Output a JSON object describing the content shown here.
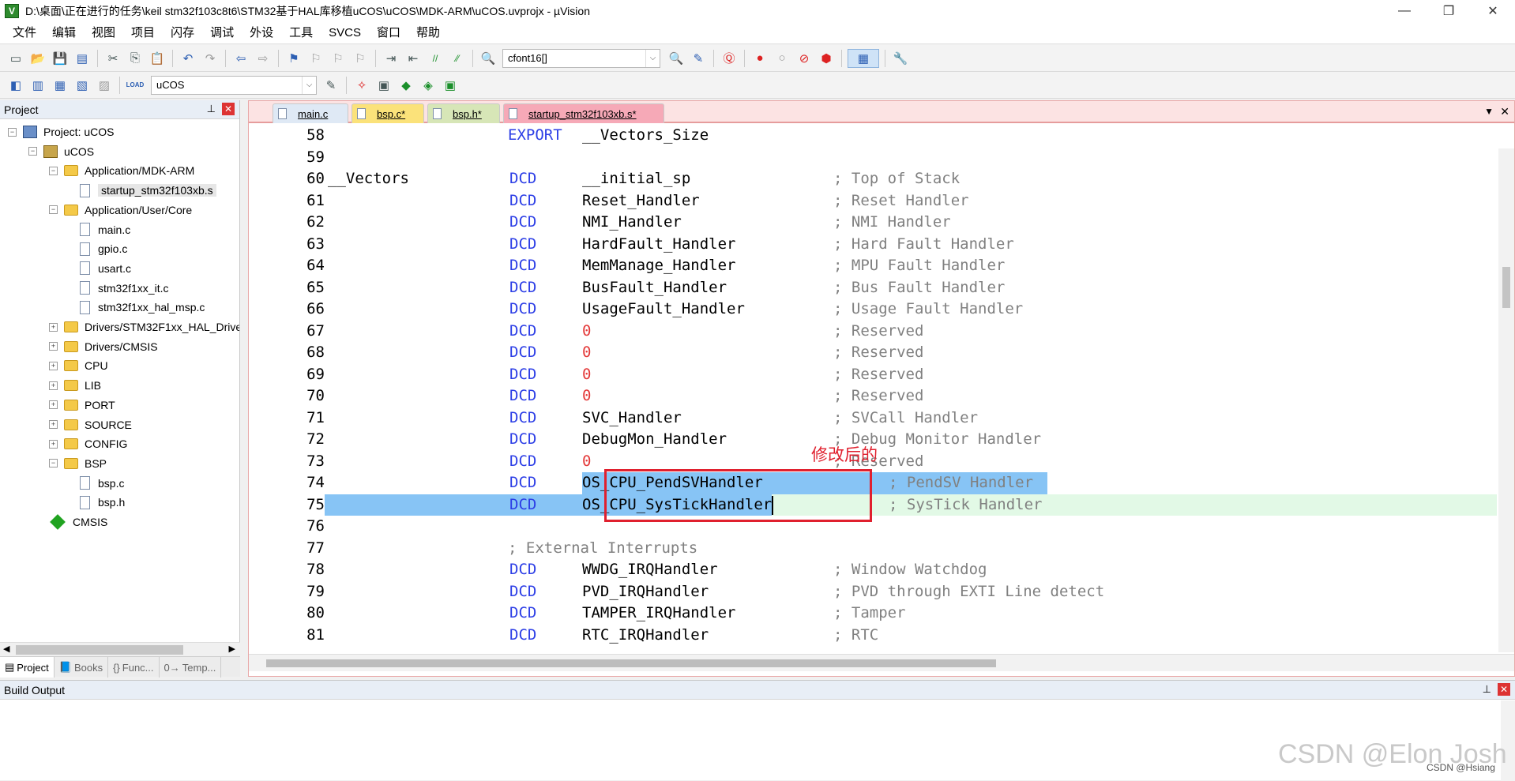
{
  "window": {
    "title": "D:\\桌面\\正在进行的任务\\keil stm32f103c8t6\\STM32基于HAL库移植uCOS\\uCOS\\MDK-ARM\\uCOS.uvprojx - µVision",
    "app_icon_letter": "V",
    "minimize_glyph": "—",
    "maximize_glyph": "❐",
    "close_glyph": "✕"
  },
  "menu": [
    "文件",
    "编辑",
    "视图",
    "项目",
    "闪存",
    "调试",
    "外设",
    "工具",
    "SVCS",
    "窗口",
    "帮助"
  ],
  "toolbar": {
    "find_combo_value": "cfont16[]",
    "target_combo_value": "uCOS",
    "combo_arrow": "⌵",
    "icons": {
      "new_file": "▭",
      "open": "📂",
      "save": "💾",
      "save_all": "▤",
      "cut": "✂",
      "copy": "⎘",
      "paste": "📋",
      "undo": "↶",
      "redo": "↷",
      "back": "⇦",
      "forward": "⇨",
      "bookmark": "⚑",
      "bookmark_prev": "⚐",
      "bookmark_next": "⚐",
      "bookmark_clear": "⚐",
      "indent": "⇥",
      "unindent": "⇤",
      "comment": "//",
      "uncomment": "⁄⁄",
      "find_in_files": "🔍",
      "debug": "Ⓠ",
      "breakpoint": "●",
      "breakpoint_disable": "○",
      "breakpoint_disable_all": "⊘",
      "breakpoint_kill": "⬢",
      "window": "▦",
      "config": "🔧",
      "translate": "◧",
      "build": "▥",
      "rebuild": "▦",
      "batch_build": "▧",
      "stop_build": "▨",
      "load": "LOAD",
      "target_options": "✎",
      "manage_components": "✧",
      "select_packs": "◆",
      "pack_installer": "◈",
      "rte": "▣"
    }
  },
  "project_panel": {
    "title": "Project",
    "pin": "⊥",
    "close": "✕",
    "tree": [
      {
        "label": "Project: uCOS",
        "level": 0,
        "type": "project",
        "expander": "−"
      },
      {
        "label": "uCOS",
        "level": 1,
        "type": "target",
        "expander": "−"
      },
      {
        "label": "Application/MDK-ARM",
        "level": 2,
        "type": "folder",
        "expander": "−"
      },
      {
        "label": "startup_stm32f103xb.s",
        "level": 3,
        "type": "file",
        "selected": true
      },
      {
        "label": "Application/User/Core",
        "level": 2,
        "type": "folder",
        "expander": "−"
      },
      {
        "label": "main.c",
        "level": 3,
        "type": "file"
      },
      {
        "label": "gpio.c",
        "level": 3,
        "type": "file"
      },
      {
        "label": "usart.c",
        "level": 3,
        "type": "file"
      },
      {
        "label": "stm32f1xx_it.c",
        "level": 3,
        "type": "file"
      },
      {
        "label": "stm32f1xx_hal_msp.c",
        "level": 3,
        "type": "file"
      },
      {
        "label": "Drivers/STM32F1xx_HAL_Drive",
        "level": 2,
        "type": "folder",
        "expander": "+"
      },
      {
        "label": "Drivers/CMSIS",
        "level": 2,
        "type": "folder",
        "expander": "+"
      },
      {
        "label": "CPU",
        "level": 2,
        "type": "folder",
        "expander": "+"
      },
      {
        "label": "LIB",
        "level": 2,
        "type": "folder",
        "expander": "+"
      },
      {
        "label": "PORT",
        "level": 2,
        "type": "folder",
        "expander": "+"
      },
      {
        "label": "SOURCE",
        "level": 2,
        "type": "folder",
        "expander": "+"
      },
      {
        "label": "CONFIG",
        "level": 2,
        "type": "folder",
        "expander": "+"
      },
      {
        "label": "BSP",
        "level": 2,
        "type": "folder",
        "expander": "−"
      },
      {
        "label": "bsp.c",
        "level": 3,
        "type": "file"
      },
      {
        "label": "bsp.h",
        "level": 3,
        "type": "file"
      },
      {
        "label": "CMSIS",
        "level": 2,
        "type": "gem"
      }
    ],
    "scroll_left": "◀",
    "scroll_right": "▶",
    "tabs": [
      {
        "label": "Project",
        "icon": "▤",
        "active": true
      },
      {
        "label": "Books",
        "icon": "📘",
        "active": false
      },
      {
        "label": "Func...",
        "icon": "{}",
        "active": false
      },
      {
        "label": "Temp...",
        "icon": "0→",
        "active": false
      }
    ]
  },
  "editor": {
    "tabs": [
      {
        "label": "main.c",
        "color": "#dfe9f5"
      },
      {
        "label": "bsp.c*",
        "color": "#fbe27a"
      },
      {
        "label": "bsp.h*",
        "color": "#d7e6b7"
      },
      {
        "label": "startup_stm32f103xb.s*",
        "color": "#f6a9b7",
        "active": true
      }
    ],
    "tab_dropdown": "▼",
    "tab_close": "✕",
    "lines": [
      {
        "n": "58",
        "label": "",
        "op": "EXPORT",
        "arg": "__Vectors_Size",
        "comment": ""
      },
      {
        "n": "59",
        "label": "",
        "op": "",
        "arg": "",
        "comment": ""
      },
      {
        "n": "60",
        "label": "__Vectors",
        "op": "DCD",
        "arg": "__initial_sp",
        "comment": "; Top of Stack"
      },
      {
        "n": "61",
        "label": "",
        "op": "DCD",
        "arg": "Reset_Handler",
        "comment": "; Reset Handler"
      },
      {
        "n": "62",
        "label": "",
        "op": "DCD",
        "arg": "NMI_Handler",
        "comment": "; NMI Handler"
      },
      {
        "n": "63",
        "label": "",
        "op": "DCD",
        "arg": "HardFault_Handler",
        "comment": "; Hard Fault Handler"
      },
      {
        "n": "64",
        "label": "",
        "op": "DCD",
        "arg": "MemManage_Handler",
        "comment": "; MPU Fault Handler"
      },
      {
        "n": "65",
        "label": "",
        "op": "DCD",
        "arg": "BusFault_Handler",
        "comment": "; Bus Fault Handler"
      },
      {
        "n": "66",
        "label": "",
        "op": "DCD",
        "arg": "UsageFault_Handler",
        "comment": "; Usage Fault Handler"
      },
      {
        "n": "67",
        "label": "",
        "op": "DCD",
        "arg": "0",
        "comment": "; Reserved"
      },
      {
        "n": "68",
        "label": "",
        "op": "DCD",
        "arg": "0",
        "comment": "; Reserved"
      },
      {
        "n": "69",
        "label": "",
        "op": "DCD",
        "arg": "0",
        "comment": "; Reserved"
      },
      {
        "n": "70",
        "label": "",
        "op": "DCD",
        "arg": "0",
        "comment": "; Reserved"
      },
      {
        "n": "71",
        "label": "",
        "op": "DCD",
        "arg": "SVC_Handler",
        "comment": "; SVCall Handler"
      },
      {
        "n": "72",
        "label": "",
        "op": "DCD",
        "arg": "DebugMon_Handler",
        "comment": "; Debug Monitor Handler"
      },
      {
        "n": "73",
        "label": "",
        "op": "DCD",
        "arg": "0",
        "comment": "; Reserved"
      },
      {
        "n": "74",
        "label": "",
        "op": "DCD",
        "arg": "OS_CPU_PendSVHandler",
        "comment": "; PendSV Handler"
      },
      {
        "n": "75",
        "label": "",
        "op": "DCD",
        "arg": "OS_CPU_SysTickHandler",
        "comment": "; SysTick Handler"
      },
      {
        "n": "76",
        "label": "",
        "op": "",
        "arg": "",
        "comment": ""
      },
      {
        "n": "77",
        "label": "",
        "op": "",
        "arg": "",
        "comment": "; External Interrupts"
      },
      {
        "n": "78",
        "label": "",
        "op": "DCD",
        "arg": "WWDG_IRQHandler",
        "comment": "; Window Watchdog"
      },
      {
        "n": "79",
        "label": "",
        "op": "DCD",
        "arg": "PVD_IRQHandler",
        "comment": "; PVD through EXTI Line detect"
      },
      {
        "n": "80",
        "label": "",
        "op": "DCD",
        "arg": "TAMPER_IRQHandler",
        "comment": "; Tamper"
      },
      {
        "n": "81",
        "label": "",
        "op": "DCD",
        "arg": "RTC_IRQHandler",
        "comment": "; RTC"
      }
    ],
    "annotation": "修改后的",
    "colors": {
      "keyword": "#2c3ee6",
      "number": "#e43a3a",
      "comment": "#808080",
      "selection": "#87c4f5",
      "current_line": "#e2f9e6",
      "annotation": "#e0202e"
    }
  },
  "build_output": {
    "title": "Build Output",
    "pin": "⊥",
    "close": "✕"
  },
  "watermark": {
    "main": "CSDN @Elon Josh",
    "small": "CSDN @Hsiang"
  }
}
